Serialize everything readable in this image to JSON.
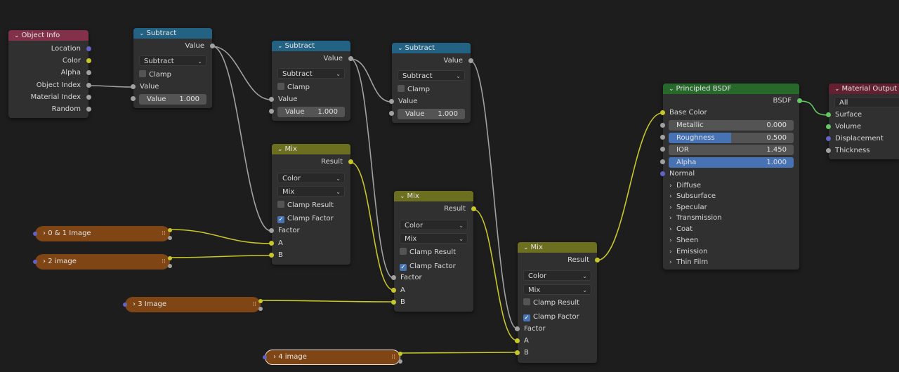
{
  "nodes": {
    "object_info": {
      "title": "Object Info",
      "outputs": [
        "Location",
        "Color",
        "Alpha",
        "Object Index",
        "Material Index",
        "Random"
      ]
    },
    "subtract1": {
      "title": "Subtract",
      "output": "Value",
      "operation": "Subtract",
      "clamp_label": "Clamp",
      "input_label": "Value",
      "value_label": "Value",
      "value": "1.000"
    },
    "subtract2": {
      "title": "Subtract",
      "output": "Value",
      "operation": "Subtract",
      "clamp_label": "Clamp",
      "input_label": "Value",
      "value_label": "Value",
      "value": "1.000"
    },
    "subtract3": {
      "title": "Subtract",
      "output": "Value",
      "operation": "Subtract",
      "clamp_label": "Clamp",
      "input_label": "Value",
      "value_label": "Value",
      "value": "1.000"
    },
    "mix1": {
      "title": "Mix",
      "output": "Result",
      "data_type": "Color",
      "blend": "Mix",
      "clamp_result": "Clamp Result",
      "clamp_factor": "Clamp Factor",
      "factor": "Factor",
      "a": "A",
      "b": "B"
    },
    "mix2": {
      "title": "Mix",
      "output": "Result",
      "data_type": "Color",
      "blend": "Mix",
      "clamp_result": "Clamp Result",
      "clamp_factor": "Clamp Factor",
      "factor": "Factor",
      "a": "A",
      "b": "B"
    },
    "mix3": {
      "title": "Mix",
      "output": "Result",
      "data_type": "Color",
      "blend": "Mix",
      "clamp_result": "Clamp Result",
      "clamp_factor": "Clamp Factor",
      "factor": "Factor",
      "a": "A",
      "b": "B"
    },
    "principled": {
      "title": "Principled BSDF",
      "output": "BSDF",
      "base_color": "Base Color",
      "metallic": {
        "label": "Metallic",
        "value": "0.000",
        "fraction": 0
      },
      "roughness": {
        "label": "Roughness",
        "value": "0.500",
        "fraction": 0.5
      },
      "ior": {
        "label": "IOR",
        "value": "1.450",
        "fraction": 0
      },
      "alpha": {
        "label": "Alpha",
        "value": "1.000",
        "fraction": 1
      },
      "normal": "Normal",
      "panels": [
        "Diffuse",
        "Subsurface",
        "Specular",
        "Transmission",
        "Coat",
        "Sheen",
        "Emission",
        "Thin Film"
      ]
    },
    "material_output": {
      "title": "Material Output",
      "target": "All",
      "inputs": [
        "Surface",
        "Volume",
        "Displacement",
        "Thickness"
      ]
    }
  },
  "frames": {
    "f1": "0 & 1 Image",
    "f2": "2 image",
    "f3": "3 Image",
    "f4": "4 image"
  },
  "colors": {
    "canvas": "#1d1d1d",
    "header_input": "#83314a",
    "header_converter": "#246283",
    "header_mix": "#6b6f1f",
    "header_shader": "#27692b",
    "header_output": "#632031",
    "frame": "#7f4514",
    "wire_gray": "#a1a1a1",
    "wire_yellow": "#c7c729",
    "wire_green": "#63c763",
    "slider_blue": "#4772b3"
  },
  "icons": {
    "collapse": "chevron-down-icon",
    "panel": "chevron-right-icon",
    "check": "checkmark-icon"
  }
}
